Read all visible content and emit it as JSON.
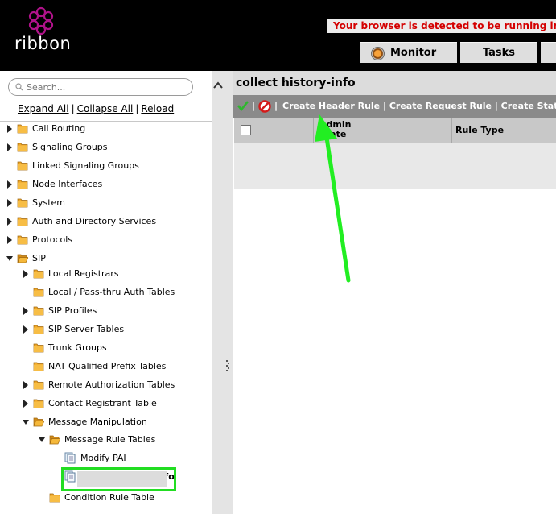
{
  "header": {
    "logo_text": "ribbon",
    "warning": "Your browser is detected to be running in C",
    "tabs": [
      {
        "label": "Monitor"
      },
      {
        "label": "Tasks"
      }
    ]
  },
  "sidebar": {
    "search_placeholder": "Search...",
    "links": {
      "expand": "Expand All",
      "collapse": "Collapse All",
      "reload": "Reload"
    },
    "tree": [
      {
        "label": "Call Routing",
        "expandable": true
      },
      {
        "label": "Signaling Groups",
        "expandable": true
      },
      {
        "label": "Linked Signaling Groups",
        "expandable": false
      },
      {
        "label": "Node Interfaces",
        "expandable": true
      },
      {
        "label": "System",
        "expandable": true
      },
      {
        "label": "Auth and Directory Services",
        "expandable": true
      },
      {
        "label": "Protocols",
        "expandable": true
      },
      {
        "label": "SIP",
        "expandable": true,
        "expanded": true
      },
      {
        "label": "Local Registrars",
        "expandable": true
      },
      {
        "label": "Local / Pass-thru Auth Tables",
        "expandable": false
      },
      {
        "label": "SIP Profiles",
        "expandable": true
      },
      {
        "label": "SIP Server Tables",
        "expandable": true
      },
      {
        "label": "Trunk Groups",
        "expandable": false
      },
      {
        "label": "NAT Qualified Prefix Tables",
        "expandable": false
      },
      {
        "label": "Remote Authorization Tables",
        "expandable": true
      },
      {
        "label": "Contact Registrant Table",
        "expandable": true
      },
      {
        "label": "Message Manipulation",
        "expandable": true,
        "expanded": true
      },
      {
        "label": "Message Rule Tables",
        "expandable": true,
        "expanded": true
      },
      {
        "label": "Modify PAI",
        "type": "document"
      },
      {
        "label": "collect history-info",
        "type": "document",
        "selected": true
      },
      {
        "label": "Condition Rule Table",
        "expandable": false
      }
    ]
  },
  "main": {
    "title": "collect history-info",
    "toolbar": {
      "links": "Create Header Rule | Create Request Rule | Create Status Ru"
    },
    "grid": {
      "col_admin": "Admin\nState",
      "col_admin_l1": "Admin",
      "col_admin_l2": "State",
      "col_rule_type": "Rule Type"
    }
  },
  "colors": {
    "highlight": "#22dd22",
    "warning": "#d40000",
    "folder": "#f0a828"
  }
}
